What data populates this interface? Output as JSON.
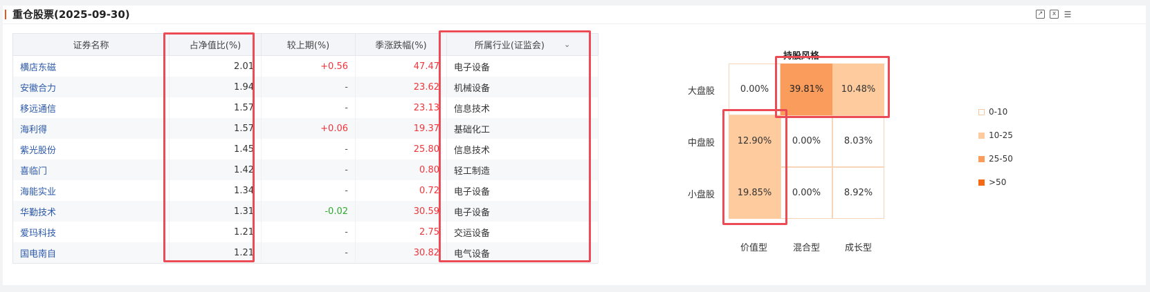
{
  "header": {
    "title": "重仓股票(2025-09-30)",
    "icons": [
      "chart-export-icon",
      "excel-export-icon",
      "menu-list-icon"
    ]
  },
  "table": {
    "columns": {
      "name": "证券名称",
      "pct_nav": "占净值比(%)",
      "change": "较上期(%)",
      "season_change": "季涨跌幅(%)",
      "industry": "所属行业(证监会)"
    },
    "rows": [
      {
        "name": "横店东磁",
        "pct_nav": "2.01",
        "change": "+0.56",
        "season_change": "47.47",
        "industry": "电子设备"
      },
      {
        "name": "安徽合力",
        "pct_nav": "1.94",
        "change": "-",
        "season_change": "23.62",
        "industry": "机械设备"
      },
      {
        "name": "移远通信",
        "pct_nav": "1.57",
        "change": "-",
        "season_change": "23.13",
        "industry": "信息技术"
      },
      {
        "name": "海利得",
        "pct_nav": "1.57",
        "change": "+0.06",
        "season_change": "19.37",
        "industry": "基础化工"
      },
      {
        "name": "紫光股份",
        "pct_nav": "1.45",
        "change": "-",
        "season_change": "25.80",
        "industry": "信息技术"
      },
      {
        "name": "喜临门",
        "pct_nav": "1.42",
        "change": "-",
        "season_change": "0.80",
        "industry": "轻工制造"
      },
      {
        "name": "海能实业",
        "pct_nav": "1.34",
        "change": "-",
        "season_change": "0.72",
        "industry": "电子设备"
      },
      {
        "name": "华勤技术",
        "pct_nav": "1.31",
        "change": "-0.02",
        "season_change": "30.59",
        "industry": "电子设备"
      },
      {
        "name": "爱玛科技",
        "pct_nav": "1.21",
        "change": "-",
        "season_change": "2.75",
        "industry": "交运设备"
      },
      {
        "name": "国电南自",
        "pct_nav": "1.21",
        "change": "-",
        "season_change": "30.82",
        "industry": "电气设备"
      }
    ]
  },
  "style_box": {
    "title": "持股风格",
    "row_labels": [
      "大盘股",
      "中盘股",
      "小盘股"
    ],
    "col_labels": [
      "价值型",
      "混合型",
      "成长型"
    ],
    "cells": [
      [
        "0.00%",
        "39.81%",
        "10.48%"
      ],
      [
        "12.90%",
        "0.00%",
        "8.03%"
      ],
      [
        "19.85%",
        "0.00%",
        "8.92%"
      ]
    ],
    "legend": [
      {
        "label": "0-10",
        "color": "#ffffff"
      },
      {
        "label": "10-25",
        "color": "#fdcb9e"
      },
      {
        "label": "25-50",
        "color": "#fa9c5b"
      },
      {
        "label": ">50",
        "color": "#f46a14"
      }
    ]
  },
  "colors": {
    "accent": "#e8541e",
    "highlight_border": "#ec4a55",
    "link": "#2b58a8",
    "up": "#f0343a",
    "down": "#2fa82f"
  }
}
